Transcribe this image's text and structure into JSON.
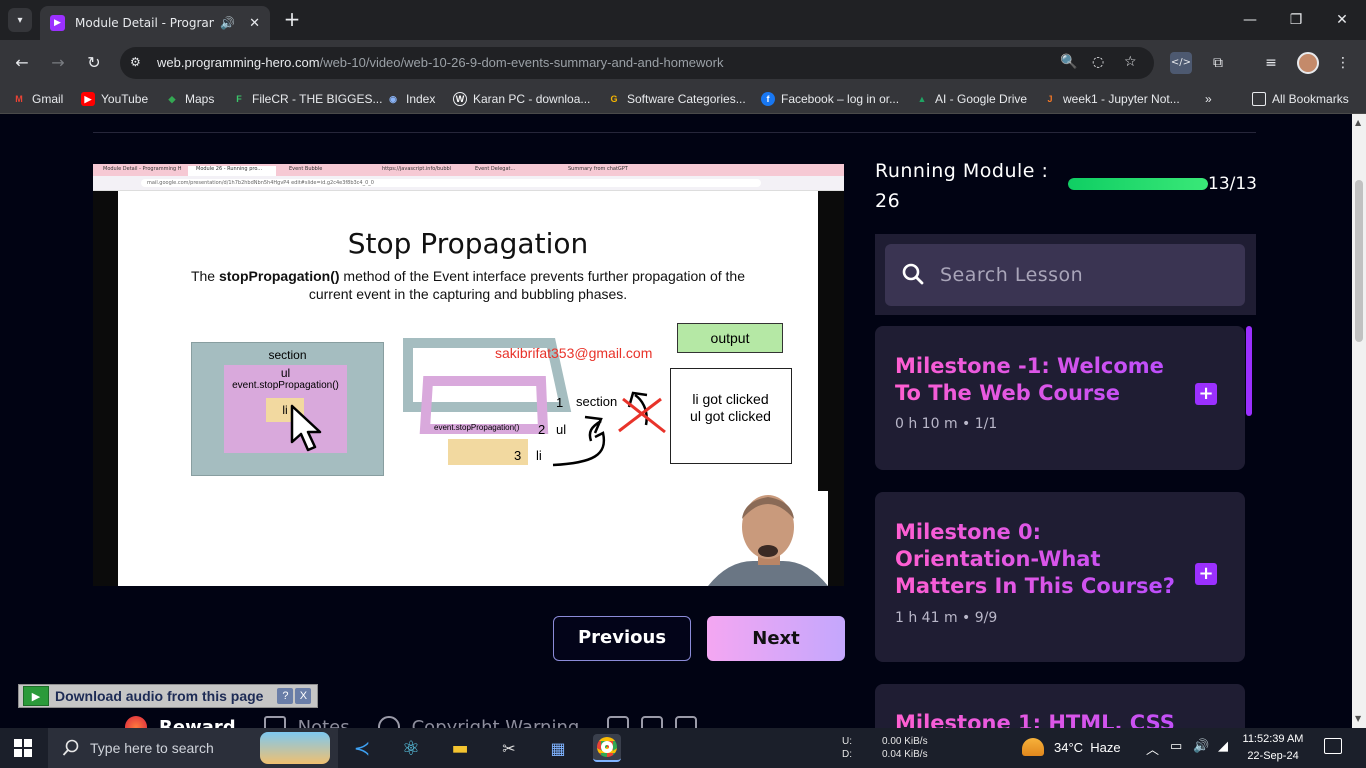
{
  "browser": {
    "tab_title": "Module Detail - Programming Hero",
    "url_host": "web.programming-hero.com",
    "url_path": "/web-10/video/web-10-26-9-dom-events-summary-and-and-homework",
    "bookmarks": [
      {
        "label": "Gmail",
        "color": "#ea4335",
        "glyph": "M"
      },
      {
        "label": "YouTube",
        "color": "#ff0000",
        "glyph": "▶"
      },
      {
        "label": "Maps",
        "color": "#34a853",
        "glyph": "◆"
      },
      {
        "label": "FileCR - THE BIGGES...",
        "color": "#3bc76a",
        "glyph": "F"
      },
      {
        "label": "Index",
        "color": "#8ab4f8",
        "glyph": "◉"
      },
      {
        "label": "Karan PC - downloa...",
        "color": "#6b8cc7",
        "glyph": "W"
      },
      {
        "label": "Software Categories...",
        "color": "#f5b400",
        "glyph": "G"
      },
      {
        "label": "Facebook – log in or...",
        "color": "#1877f2",
        "glyph": "f"
      },
      {
        "label": "AI - Google Drive",
        "color": "#1fa463",
        "glyph": "▲"
      },
      {
        "label": "week1 - Jupyter Not...",
        "color": "#f37726",
        "glyph": "J"
      }
    ],
    "all_bookmarks": "All Bookmarks"
  },
  "video": {
    "inner_tabs": [
      "Module Detail - Programming H",
      "Module 26 - Running pro...",
      "Event Bubble",
      "https://javascript.info/bubbl",
      "Event Delegat...",
      "Summary from chatGPT"
    ],
    "inner_url": "mail.google.com/presentation/d/1h7b2hbdNbn5h4HgvP4 edit#slide=id.g2c4e3f8b3c4_0_0",
    "slide_title": "Stop Propagation",
    "slide_desc_pre": "The ",
    "slide_desc_bold": "stopPropagation()",
    "slide_desc_post": " method of the Event interface prevents further propagation of the current event in the capturing and bubbling phases.",
    "box_section": "section",
    "box_ul": "ul",
    "box_ul_method": "event.stopPropagation()",
    "box_li": "li",
    "email": "sakibrifat353@gmail.com",
    "output_label": "output",
    "result_line1": "li got clicked",
    "result_line2": "ul got clicked",
    "diagram_stop": "event.stopPropagation()",
    "diagram_levels": [
      {
        "num": "1",
        "label": "section"
      },
      {
        "num": "2",
        "label": "ul"
      },
      {
        "num": "3",
        "label": "li"
      }
    ]
  },
  "nav": {
    "previous": "Previous",
    "next": "Next"
  },
  "bottom_tabs": {
    "reward": "Reward",
    "notes": "Notes",
    "copyright": "Copyright Warning"
  },
  "download_bar": {
    "label": "Download audio from this page",
    "help": "?",
    "close": "X"
  },
  "sidebar": {
    "running_label": "Running Module :",
    "running_number": "26",
    "progress_text": "13/13",
    "progress_fraction": 1.0,
    "search_placeholder": "Search Lesson",
    "milestones": [
      {
        "title": "Milestone -1: Welcome To The Web Course",
        "duration": "0 h 10 m",
        "count": "1/1"
      },
      {
        "title": "Milestone 0: Orientation-What Matters In This Course?",
        "duration": "1 h 41 m",
        "count": "9/9"
      },
      {
        "title": "Milestone 1: HTML, CSS",
        "duration": "",
        "count": ""
      }
    ]
  },
  "taskbar": {
    "search_placeholder": "Type here to search",
    "net_up_label": "U:",
    "net_down_label": "D:",
    "net_up": "0.00 KiB/s",
    "net_down": "0.04 KiB/s",
    "temperature": "34°C",
    "weather": "Haze",
    "time": "11:52:39 AM",
    "date": "22-Sep-24"
  },
  "colors": {
    "page_bg": "#010313",
    "accent_purple": "#9b30ff",
    "progress_green": "#0fce63",
    "milestone_pink": "#ff5fd1"
  }
}
